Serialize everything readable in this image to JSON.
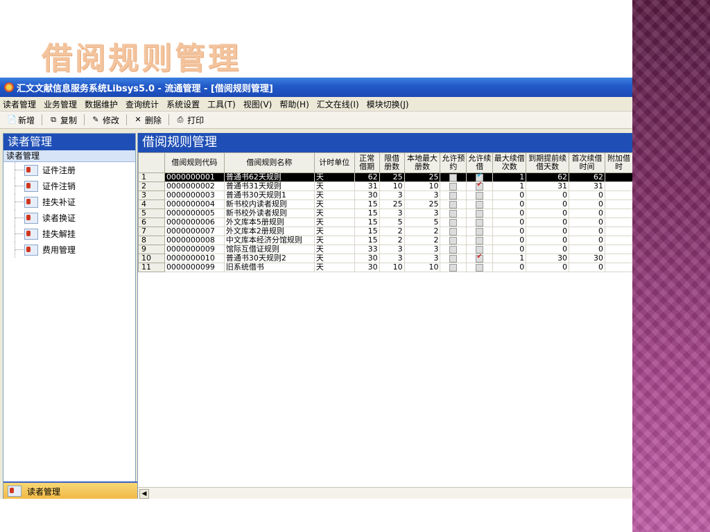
{
  "slide_title": "借阅规则管理",
  "window": {
    "title": "汇文文献信息服务系统Libsys5.0 - 流通管理 - [借阅规则管理]"
  },
  "menu": [
    "读者管理",
    "业务管理",
    "数据维护",
    "查询统计",
    "系统设置",
    "工具(T)",
    "视图(V)",
    "帮助(H)",
    "汇文在线(I)",
    "模块切换(J)"
  ],
  "toolbar": {
    "new": "新增",
    "copy": "复制",
    "edit": "修改",
    "delete": "删除",
    "print": "打印"
  },
  "left_panel": {
    "title": "读者管理",
    "subtitle": "读者管理",
    "items": [
      "证件注册",
      "证件注销",
      "挂失补证",
      "读者换证",
      "挂失解挂",
      "费用管理"
    ],
    "bottom_label": "读者管理"
  },
  "right_panel": {
    "title": "借阅规则管理",
    "columns": [
      "借阅规则代码",
      "借阅规则名称",
      "计时单位",
      "正常借期",
      "限借册数",
      "本地最大册数",
      "允许预约",
      "允许续借",
      "最大续借次数",
      "到期提前续借天数",
      "首次续借时间",
      "附加借时"
    ],
    "rows": [
      {
        "n": "1",
        "code": "0000000001",
        "name": "普通书62天规则",
        "unit": "天",
        "normal": "62",
        "limit": "25",
        "local": "25",
        "reserve": false,
        "renew": true,
        "max_renew": "1",
        "ahead": "62",
        "first": "62"
      },
      {
        "n": "2",
        "code": "0000000002",
        "name": "普通书31天规则",
        "unit": "天",
        "normal": "31",
        "limit": "10",
        "local": "10",
        "reserve": false,
        "renew": true,
        "max_renew": "1",
        "ahead": "31",
        "first": "31"
      },
      {
        "n": "3",
        "code": "0000000003",
        "name": "普通书30天规则1",
        "unit": "天",
        "normal": "30",
        "limit": "3",
        "local": "3",
        "reserve": false,
        "renew": false,
        "max_renew": "0",
        "ahead": "0",
        "first": "0"
      },
      {
        "n": "4",
        "code": "0000000004",
        "name": "新书校内读者规则",
        "unit": "天",
        "normal": "15",
        "limit": "25",
        "local": "25",
        "reserve": false,
        "renew": false,
        "max_renew": "0",
        "ahead": "0",
        "first": "0"
      },
      {
        "n": "5",
        "code": "0000000005",
        "name": "新书校外读者规则",
        "unit": "天",
        "normal": "15",
        "limit": "3",
        "local": "3",
        "reserve": false,
        "renew": false,
        "max_renew": "0",
        "ahead": "0",
        "first": "0"
      },
      {
        "n": "6",
        "code": "0000000006",
        "name": "外文库本5册规则",
        "unit": "天",
        "normal": "15",
        "limit": "5",
        "local": "5",
        "reserve": false,
        "renew": false,
        "max_renew": "0",
        "ahead": "0",
        "first": "0"
      },
      {
        "n": "7",
        "code": "0000000007",
        "name": "外文库本2册规则",
        "unit": "天",
        "normal": "15",
        "limit": "2",
        "local": "2",
        "reserve": false,
        "renew": false,
        "max_renew": "0",
        "ahead": "0",
        "first": "0"
      },
      {
        "n": "8",
        "code": "0000000008",
        "name": "中文库本经济分馆规则",
        "unit": "天",
        "normal": "15",
        "limit": "2",
        "local": "2",
        "reserve": false,
        "renew": false,
        "max_renew": "0",
        "ahead": "0",
        "first": "0"
      },
      {
        "n": "9",
        "code": "0000000009",
        "name": "馆际互借证规则",
        "unit": "天",
        "normal": "33",
        "limit": "3",
        "local": "3",
        "reserve": false,
        "renew": false,
        "max_renew": "0",
        "ahead": "0",
        "first": "0"
      },
      {
        "n": "10",
        "code": "0000000010",
        "name": "普通书30天规则2",
        "unit": "天",
        "normal": "30",
        "limit": "3",
        "local": "3",
        "reserve": false,
        "renew": true,
        "max_renew": "1",
        "ahead": "30",
        "first": "30"
      },
      {
        "n": "11",
        "code": "0000000099",
        "name": "旧系统借书",
        "unit": "天",
        "normal": "30",
        "limit": "10",
        "local": "10",
        "reserve": false,
        "renew": false,
        "max_renew": "0",
        "ahead": "0",
        "first": "0"
      }
    ]
  },
  "colors": {
    "accent": "#1f4fb6",
    "title_peach": "#f3c49e",
    "check_red": "#d21d1d"
  }
}
